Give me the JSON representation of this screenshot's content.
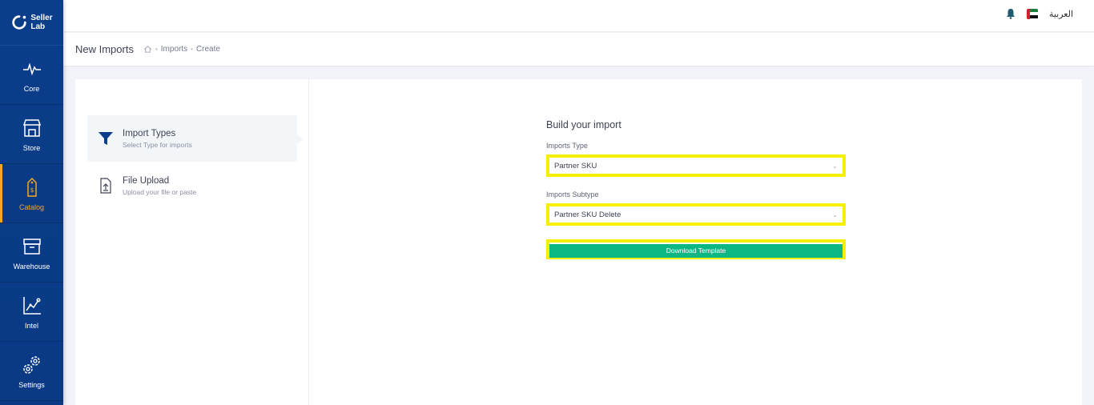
{
  "brand": {
    "line1": "Seller",
    "line2": "Lab"
  },
  "sidebar": {
    "items": [
      {
        "label": "Core",
        "icon": "pulse-icon"
      },
      {
        "label": "Store",
        "icon": "store-icon"
      },
      {
        "label": "Catalog",
        "icon": "price-tag-icon",
        "active": true
      },
      {
        "label": "Warehouse",
        "icon": "warehouse-icon"
      },
      {
        "label": "Intel",
        "icon": "chart-icon"
      },
      {
        "label": "Settings",
        "icon": "gears-icon"
      }
    ]
  },
  "topbar": {
    "language": "العربية",
    "flag": "uae-flag-icon",
    "bell": "bell-icon"
  },
  "subheader": {
    "title": "New Imports",
    "breadcrumb": [
      "Imports",
      "Create"
    ]
  },
  "steps": [
    {
      "title": "Import Types",
      "subtitle": "Select Type for imports",
      "icon": "funnel-icon",
      "active": true
    },
    {
      "title": "File Upload",
      "subtitle": "Upload your file or paste",
      "icon": "file-upload-icon"
    }
  ],
  "form": {
    "title": "Build your import",
    "imports_type_label": "Imports Type",
    "imports_type_value": "Partner SKU",
    "imports_subtype_label": "Imports Subtype",
    "imports_subtype_value": "Partner SKU Delete",
    "download_button": "Download Template"
  },
  "colors": {
    "sidebar": "#0a3d8a",
    "accent": "#f4a81d",
    "primary": "#0bb783",
    "highlight": "#f6f000"
  }
}
